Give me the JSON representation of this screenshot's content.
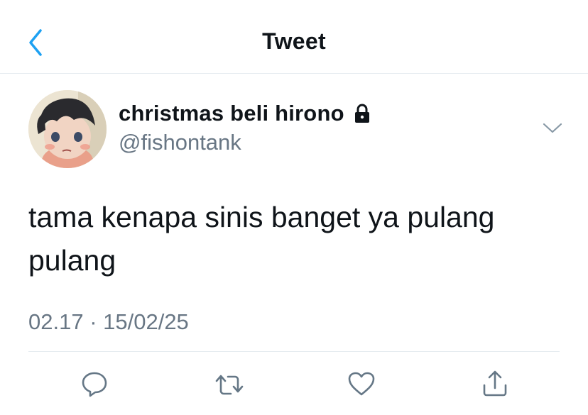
{
  "header": {
    "title": "Tweet",
    "back_icon": "chevron-left-icon",
    "accent": "#1da1f2"
  },
  "tweet": {
    "display_name": "christmas beli hirono",
    "handle": "@fishontank",
    "protected": true,
    "text": "tama kenapa sinis banget ya pulang pulang",
    "timestamp": "02.17 · 15/02/25"
  },
  "actions": [
    {
      "name": "reply",
      "icon": "reply-icon"
    },
    {
      "name": "retweet",
      "icon": "retweet-icon"
    },
    {
      "name": "like",
      "icon": "heart-icon"
    },
    {
      "name": "share",
      "icon": "share-icon"
    }
  ],
  "colors": {
    "text": "#0f1419",
    "secondary": "#687684",
    "divider": "#e6ecf0",
    "icon": "#657786"
  }
}
